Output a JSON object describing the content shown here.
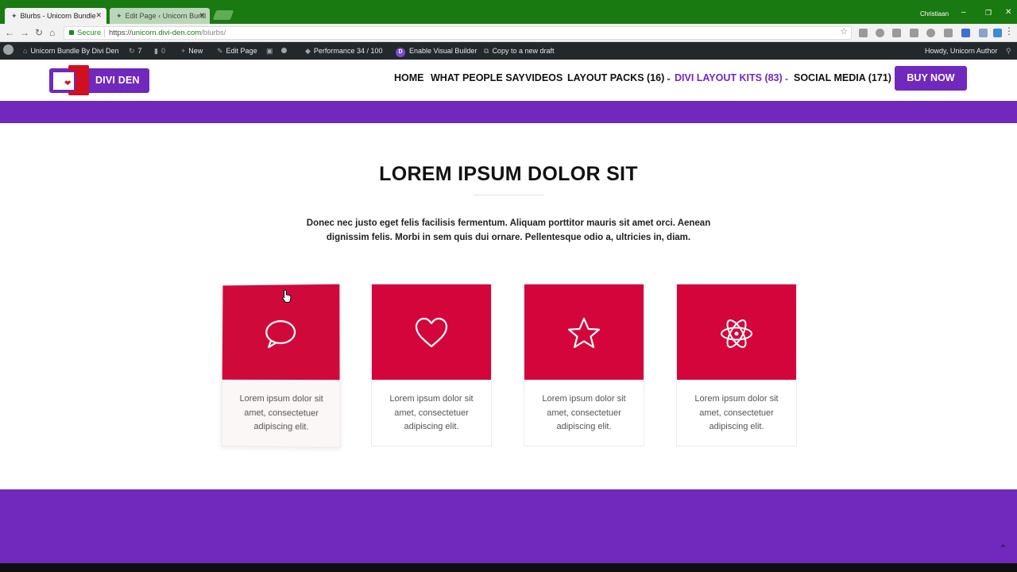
{
  "browser": {
    "tabs": [
      {
        "title": "Blurbs - Unicorn Bundle"
      },
      {
        "title": "Edit Page ‹ Unicorn Bund"
      }
    ],
    "user": "Christiaan",
    "secure_label": "Secure",
    "url_scheme": "https://",
    "url_host": "unicorn.divi-den.com",
    "url_path": "/blurbs/"
  },
  "adminbar": {
    "site_name": "Unicorn Bundle By Divi Den",
    "updates": "7",
    "comments": "0",
    "new_label": "New",
    "edit_page": "Edit Page",
    "performance": "Performance 34 / 100",
    "visual_builder": "Enable Visual Builder",
    "copy_draft": "Copy to a new draft",
    "howdy": "Howdy, Unicorn Author"
  },
  "header": {
    "logo_text": "DIVI DEN",
    "nav": [
      {
        "label": "HOME"
      },
      {
        "label": "WHAT PEOPLE SAY"
      },
      {
        "label": "VIDEOS"
      },
      {
        "label": "LAYOUT PACKS (16)"
      },
      {
        "label": "DIVI LAYOUT KITS (83)"
      },
      {
        "label": "SOCIAL MEDIA (171)"
      }
    ],
    "cta": "BUY NOW"
  },
  "main": {
    "title": "LOREM IPSUM DOLOR SIT",
    "intro": "Donec nec justo eget felis facilisis fermentum. Aliquam porttitor mauris sit amet orci. Aenean dignissim felis. Morbi in sem quis dui ornare. Pellentesque odio a, ultricies in, diam.",
    "cards": [
      {
        "icon": "speech-bubble-icon",
        "text": "Lorem ipsum dolor sit amet, consectetuer adipiscing elit."
      },
      {
        "icon": "heart-icon",
        "text": "Lorem ipsum dolor sit amet, consectetuer adipiscing elit."
      },
      {
        "icon": "star-icon",
        "text": "Lorem ipsum dolor sit amet, consectetuer adipiscing elit."
      },
      {
        "icon": "atom-icon",
        "text": "Lorem ipsum dolor sit amet, consectetuer adipiscing elit."
      }
    ]
  },
  "colors": {
    "brand_purple": "#7028bd",
    "card_red": "#d4053a",
    "chrome_green": "#1a7a12",
    "adminbar_bg": "#23282d"
  }
}
